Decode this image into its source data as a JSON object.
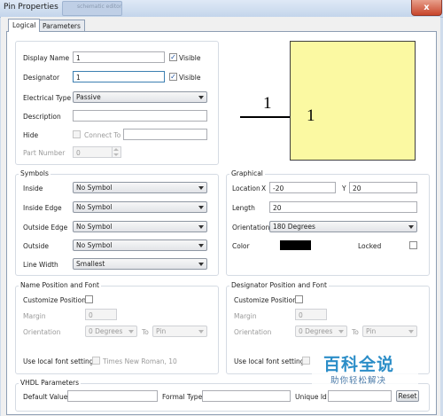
{
  "window": {
    "title": "Pin Properties",
    "ghost_tab": "schematic editor",
    "close_symbol": "x"
  },
  "tabs": [
    {
      "label": "Logical",
      "active": true
    },
    {
      "label": "Parameters",
      "active": false
    }
  ],
  "logical": {
    "display_name_label": "Display Name",
    "display_name_value": "1",
    "visible_label": "Visible",
    "display_name_visible": true,
    "designator_label": "Designator",
    "designator_value": "1",
    "designator_visible": true,
    "electrical_type_label": "Electrical Type",
    "electrical_type_value": "Passive",
    "description_label": "Description",
    "description_value": "",
    "hide_label": "Hide",
    "connect_to_label": "Connect To",
    "connect_to_value": "",
    "part_number_label": "Part Number",
    "part_number_value": "0"
  },
  "preview": {
    "pin_label_outside": "1",
    "pin_label_inside": "1",
    "body_color": "#fbf9a2"
  },
  "symbols": {
    "title": "Symbols",
    "rows": [
      {
        "label": "Inside",
        "value": "No Symbol"
      },
      {
        "label": "Inside Edge",
        "value": "No Symbol"
      },
      {
        "label": "Outside Edge",
        "value": "No Symbol"
      },
      {
        "label": "Outside",
        "value": "No Symbol"
      },
      {
        "label": "Line Width",
        "value": "Smallest"
      }
    ]
  },
  "graphical": {
    "title": "Graphical",
    "location_label": "Location",
    "x_label": "X",
    "x_value": "-20",
    "y_label": "Y",
    "y_value": "20",
    "length_label": "Length",
    "length_value": "20",
    "orientation_label": "Orientation",
    "orientation_value": "180 Degrees",
    "color_label": "Color",
    "color_value": "#000000",
    "locked_label": "Locked",
    "locked": false
  },
  "name_position": {
    "title": "Name Position and Font",
    "customize_label": "Customize Position",
    "margin_label": "Margin",
    "margin_value": "0",
    "orientation_label": "Orientation",
    "orientation_value": "0 Degrees",
    "to_label": "To",
    "to_value": "Pin",
    "font_label": "Use local font setting",
    "font_value": "Times New Roman, 10"
  },
  "designator_position": {
    "title": "Designator Position and Font",
    "customize_label": "Customize Position",
    "margin_label": "Margin",
    "margin_value": "0",
    "orientation_label": "Orientation",
    "orientation_value": "0 Degrees",
    "to_label": "To",
    "to_value": "Pin",
    "font_label": "Use local font setting"
  },
  "vhdl": {
    "title": "VHDL Parameters",
    "default_value_label": "Default Value",
    "default_value": "",
    "formal_type_label": "Formal Type",
    "formal_type": "",
    "unique_id_label": "Unique Id",
    "unique_id": "",
    "reset_label": "Reset"
  },
  "watermark": {
    "title": "百科全说",
    "subtitle": "助你轻松解决"
  }
}
